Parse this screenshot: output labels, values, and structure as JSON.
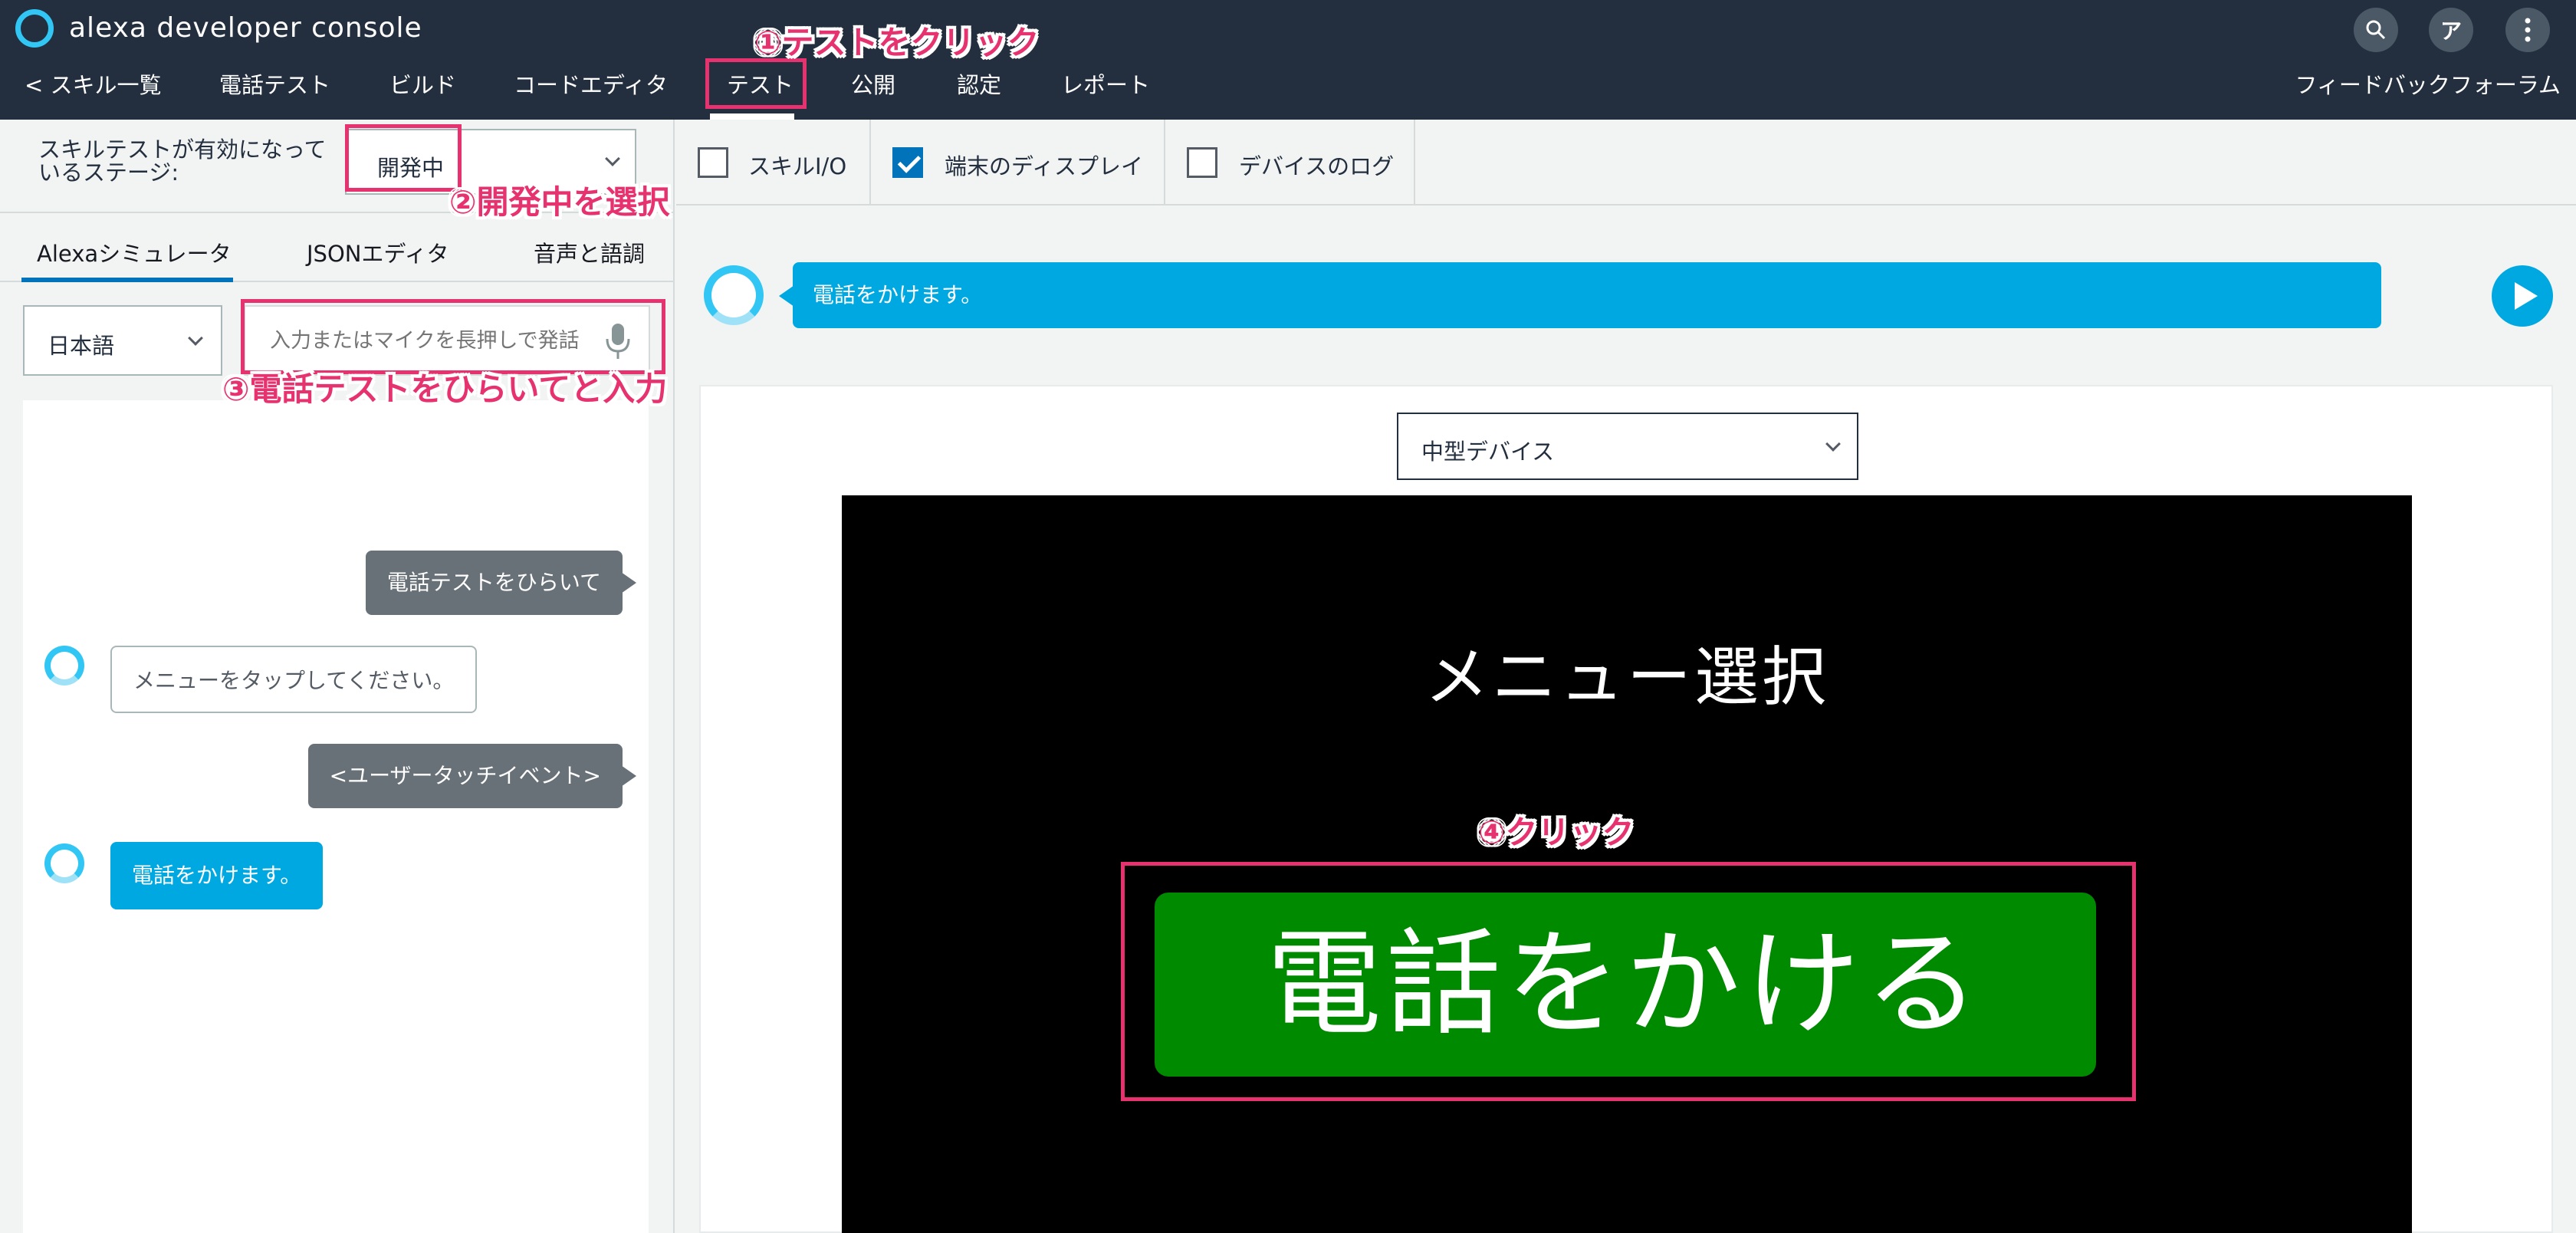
{
  "app": {
    "title": "alexa developer console"
  },
  "nav": {
    "items": [
      {
        "label": "< スキル一覧"
      },
      {
        "label": "電話テスト"
      },
      {
        "label": "ビルド"
      },
      {
        "label": "コードエディタ"
      },
      {
        "label": "テスト"
      },
      {
        "label": "公開"
      },
      {
        "label": "認定"
      },
      {
        "label": "レポート"
      }
    ],
    "active": "テスト",
    "feedback": "フィードバックフォーラム",
    "user_initial": "ア"
  },
  "stage": {
    "label": "スキルテストが有効になっているステージ:",
    "value": "開発中"
  },
  "sim_tabs": [
    "Alexaシミュレータ",
    "JSONエディタ",
    "音声と語調"
  ],
  "language": "日本語",
  "utterance": {
    "placeholder": "入力またはマイクを長押しで発話",
    "value": ""
  },
  "chat": [
    {
      "who": "user",
      "text": "電話テストをひらいて"
    },
    {
      "who": "bot",
      "text": "メニューをタップしてください。"
    },
    {
      "who": "user",
      "text": "<ユーザータッチイベント>"
    },
    {
      "who": "bot",
      "text": "電話をかけます。"
    }
  ],
  "checkboxes": [
    {
      "label": "スキルI/O",
      "checked": false
    },
    {
      "label": "端末のディスプレイ",
      "checked": true
    },
    {
      "label": "デバイスのログ",
      "checked": false
    }
  ],
  "output": {
    "text": "電話をかけます。"
  },
  "device": {
    "selected": "中型デバイス"
  },
  "screen": {
    "title": "メニュー選択",
    "button_label": "電話をかける"
  },
  "annotations": {
    "a1": "①テストをクリック",
    "a2": "②開発中を選択",
    "a3": "③電話テストをひらいてと入力",
    "a4": "④クリック"
  },
  "colors": {
    "topbar": "#232f3e",
    "accent": "#00a8e1",
    "highlight": "#e6336f",
    "call_button": "#008a00"
  }
}
